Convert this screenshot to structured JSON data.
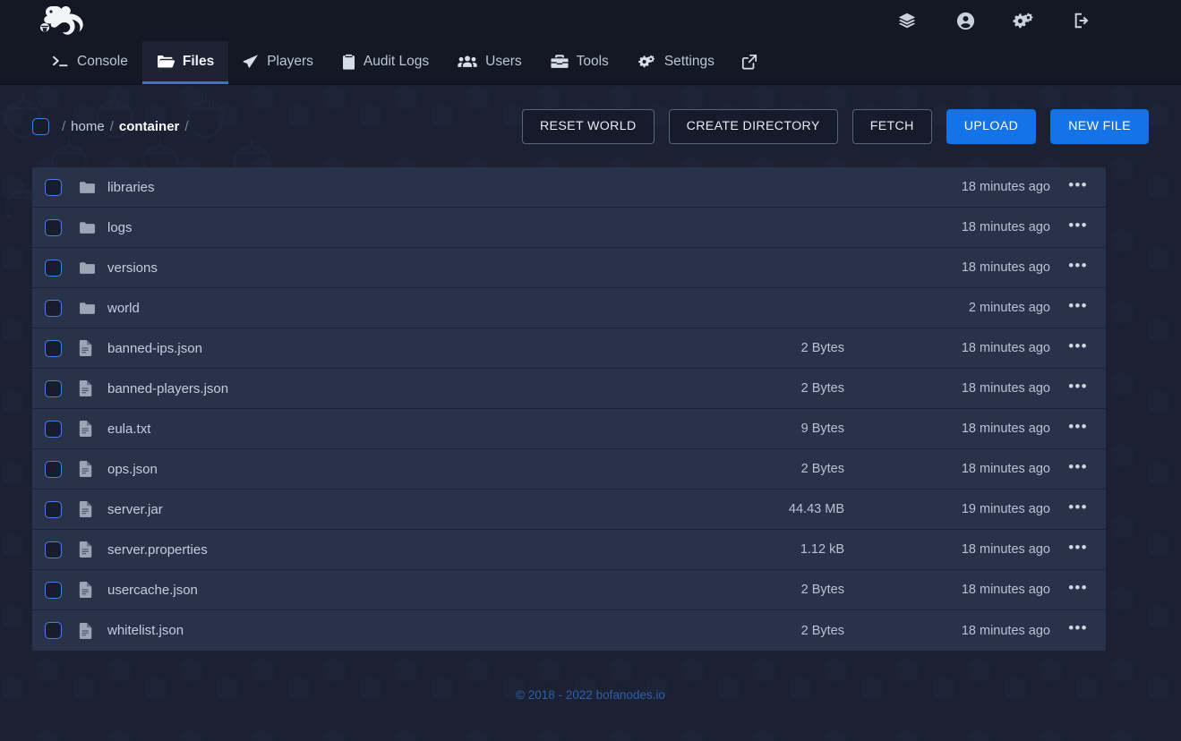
{
  "header": {
    "logo_alt": "squirrel-logo",
    "top_icons": [
      {
        "name": "layers-icon",
        "label": "Layers"
      },
      {
        "name": "account-icon",
        "label": "Account"
      },
      {
        "name": "gears-icon",
        "label": "Settings"
      },
      {
        "name": "logout-icon",
        "label": "Logout"
      }
    ],
    "tabs": [
      {
        "id": "console",
        "label": "Console",
        "icon": "terminal-icon",
        "active": false
      },
      {
        "id": "files",
        "label": "Files",
        "icon": "folder-icon",
        "active": true
      },
      {
        "id": "players",
        "label": "Players",
        "icon": "paper-plane-icon",
        "active": false
      },
      {
        "id": "audit-logs",
        "label": "Audit Logs",
        "icon": "clipboard-icon",
        "active": false
      },
      {
        "id": "users",
        "label": "Users",
        "icon": "users-icon",
        "active": false
      },
      {
        "id": "tools",
        "label": "Tools",
        "icon": "toolbox-icon",
        "active": false
      },
      {
        "id": "settings",
        "label": "Settings",
        "icon": "gears-icon",
        "active": false
      },
      {
        "id": "external",
        "label": "",
        "icon": "external-link-icon",
        "active": false
      }
    ]
  },
  "toolbar": {
    "select_all_checked": false,
    "breadcrumb": {
      "lead_separator": "/",
      "segments": [
        {
          "label": "home",
          "current": false
        },
        {
          "label": "container",
          "current": true
        }
      ],
      "trail_separator": "/"
    },
    "buttons": [
      {
        "id": "reset-world",
        "label": "RESET WORLD",
        "style": "ghost"
      },
      {
        "id": "create-directory",
        "label": "CREATE DIRECTORY",
        "style": "ghost"
      },
      {
        "id": "fetch",
        "label": "FETCH",
        "style": "ghost"
      },
      {
        "id": "upload",
        "label": "UPLOAD",
        "style": "primary"
      },
      {
        "id": "new-file",
        "label": "NEW FILE",
        "style": "primary"
      }
    ]
  },
  "files": [
    {
      "name": "libraries",
      "type": "folder",
      "size": "",
      "modified": "18 minutes ago"
    },
    {
      "name": "logs",
      "type": "folder",
      "size": "",
      "modified": "18 minutes ago"
    },
    {
      "name": "versions",
      "type": "folder",
      "size": "",
      "modified": "18 minutes ago"
    },
    {
      "name": "world",
      "type": "folder",
      "size": "",
      "modified": "2 minutes ago"
    },
    {
      "name": "banned-ips.json",
      "type": "file",
      "size": "2 Bytes",
      "modified": "18 minutes ago"
    },
    {
      "name": "banned-players.json",
      "type": "file",
      "size": "2 Bytes",
      "modified": "18 minutes ago"
    },
    {
      "name": "eula.txt",
      "type": "file",
      "size": "9 Bytes",
      "modified": "18 minutes ago"
    },
    {
      "name": "ops.json",
      "type": "file",
      "size": "2 Bytes",
      "modified": "18 minutes ago"
    },
    {
      "name": "server.jar",
      "type": "file",
      "size": "44.43 MB",
      "modified": "19 minutes ago"
    },
    {
      "name": "server.properties",
      "type": "file",
      "size": "1.12 kB",
      "modified": "18 minutes ago"
    },
    {
      "name": "usercache.json",
      "type": "file",
      "size": "2 Bytes",
      "modified": "18 minutes ago"
    },
    {
      "name": "whitelist.json",
      "type": "file",
      "size": "2 Bytes",
      "modified": "18 minutes ago"
    }
  ],
  "row_menu_glyph": "•••",
  "footer": {
    "text": "© 2018 - 2022 bofanodes.io"
  },
  "colors": {
    "page_bg": "#161b26",
    "header_bg": "#141824",
    "content_bg": "#1b2133",
    "row_bg": "#283349",
    "accent_blue": "#1473e6",
    "active_tab_underline": "#3b72d9",
    "footer_link": "#2f5fa8",
    "checkbox_border": "#4a7fe0"
  }
}
